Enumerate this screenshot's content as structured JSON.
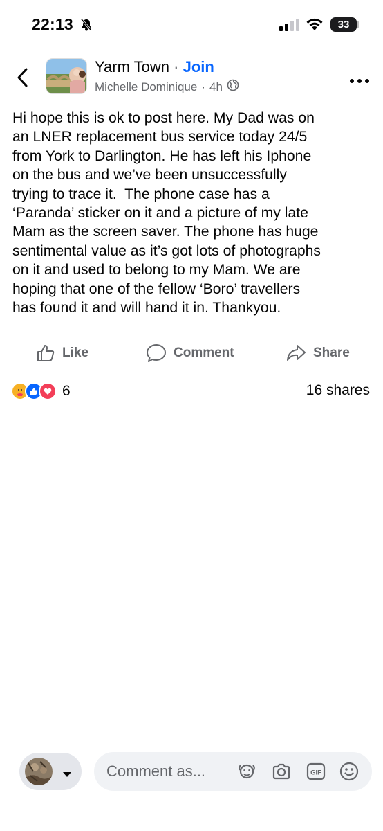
{
  "status_bar": {
    "time": "22:13",
    "battery": "33"
  },
  "header": {
    "group_name": "Yarm Town",
    "separator": "·",
    "join_label": "Join",
    "author": "Michelle Dominique",
    "dot": "·",
    "age": "4h"
  },
  "post": {
    "text": "Hi hope this is ok to post here. My Dad was on\nan LNER replacement bus service today 24/5\nfrom York to Darlington. He has left his Iphone\non the bus and we’ve been unsuccessfully\ntrying to trace it.  The phone case has a\n‘Paranda’ sticker on it and a picture of my late\nMam as the screen saver. The phone has huge\nsentimental value as it’s got lots of photographs\non it and used to belong to my Mam. We are\nhoping that one of the fellow ‘Boro’ travellers\nhas found it and will hand it in. Thankyou."
  },
  "actions": {
    "like_label": "Like",
    "comment_label": "Comment",
    "share_label": "Share"
  },
  "engagement": {
    "reaction_count": "6",
    "shares_label": "16 shares"
  },
  "composer": {
    "placeholder": "Comment as..."
  },
  "icons": [
    "back-chevron",
    "more-dots",
    "globe",
    "like-thumb",
    "comment-bubble",
    "share-arrow",
    "avatar-sticker",
    "camera",
    "gif",
    "emoji"
  ],
  "colors": {
    "accent": "#0866ff",
    "secondary_text": "#65676b",
    "love": "#f33e58",
    "care": "#f7b125"
  }
}
